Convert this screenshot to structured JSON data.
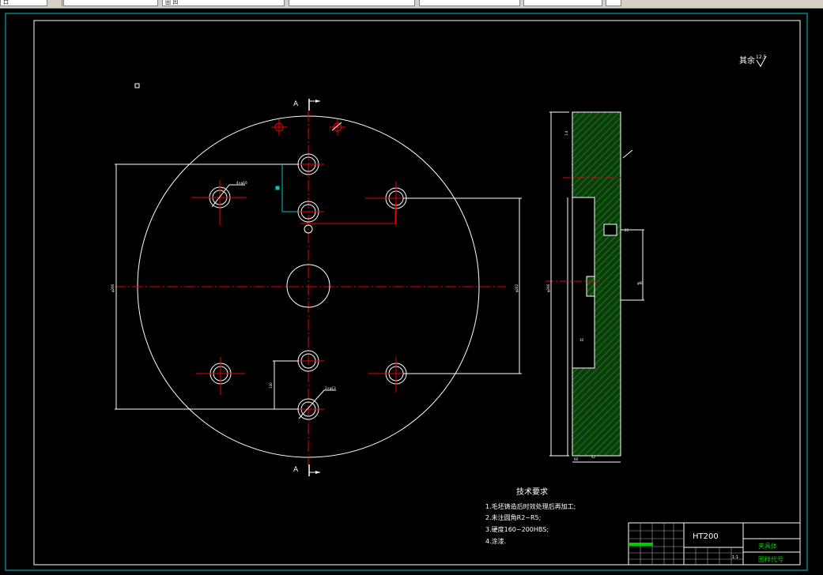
{
  "toolbar": {
    "fields": [
      "口",
      "",
      "田 凹",
      "",
      "",
      "",
      ""
    ]
  },
  "drawing": {
    "roughness_note": "其余",
    "roughness_value": "12.5",
    "section_label_top": "A",
    "section_label_bottom": "A",
    "tech_title": "技术要求",
    "tech_items": [
      "1.毛坯铸造后时效处理后再加工;",
      "2.未注圆角R2~R5;",
      "3.硬度160~200HBS;",
      "4.涂漆."
    ],
    "title_block": {
      "material": "HT200",
      "part_name": "夹具体",
      "drawing_code": "图样代号",
      "scale": "1:1"
    },
    "dims": {
      "phi_hole_left": "4×φ16",
      "phi_hole_bottom": "2×φ13",
      "phi_overall_left": "φ290",
      "phi_overall_right": "φ242",
      "pitch_lower": "140",
      "side_height": "φ290",
      "side_bottom": "60",
      "side_width": "42",
      "side_top_w": "1:4",
      "side_small_1": "25",
      "side_small_2": "φ60",
      "side_small_3": "10"
    }
  }
}
